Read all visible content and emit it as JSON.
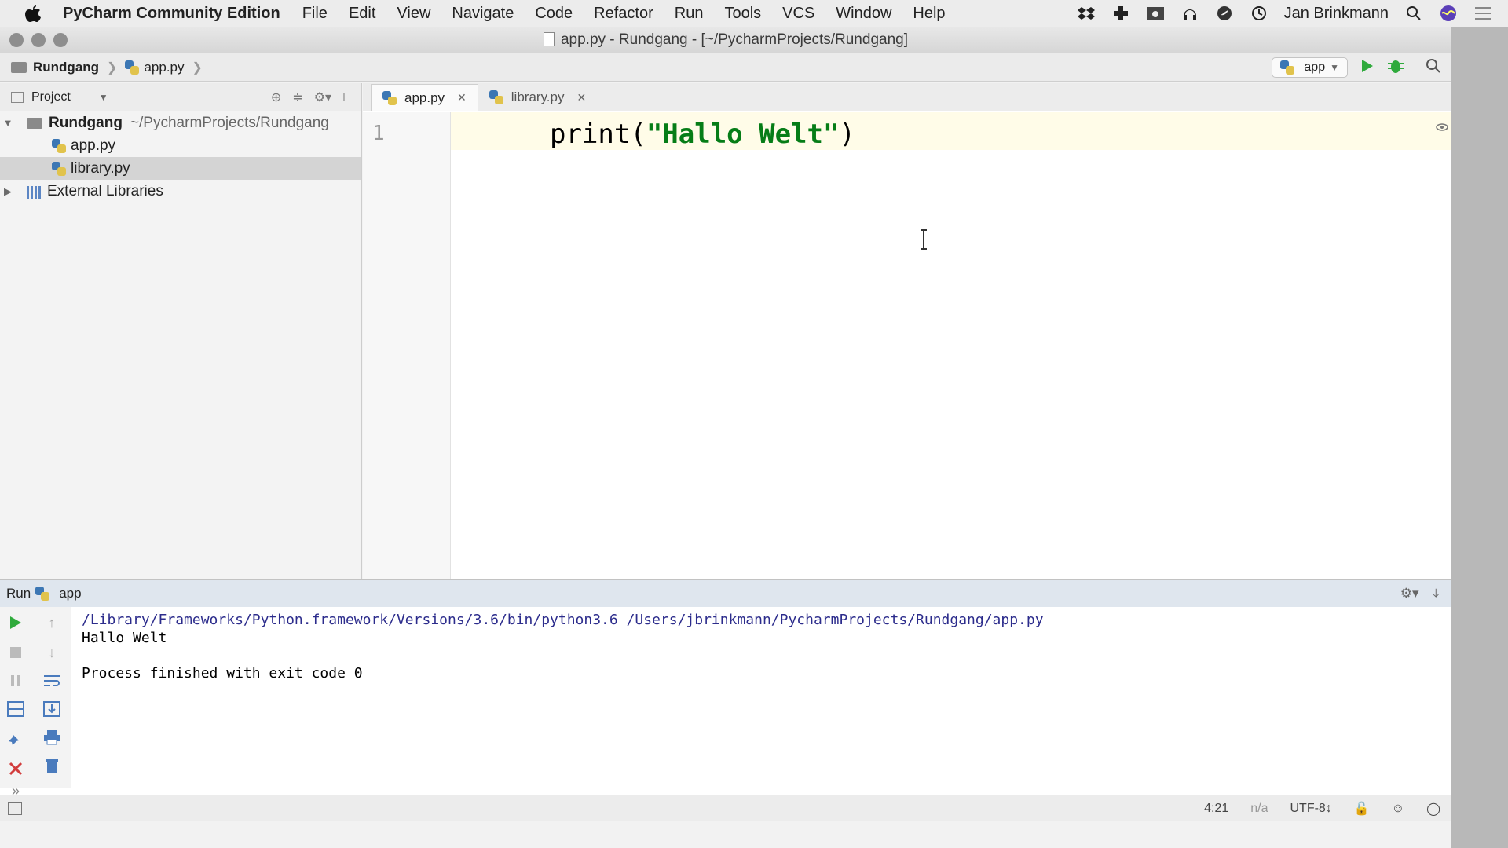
{
  "menubar": {
    "app_name": "PyCharm Community Edition",
    "menus": [
      "File",
      "Edit",
      "View",
      "Navigate",
      "Code",
      "Refactor",
      "Run",
      "Tools",
      "VCS",
      "Window",
      "Help"
    ],
    "user": "Jan Brinkmann",
    "tray_icons": [
      "dropbox-icon",
      "plugin-icon",
      "photo-icon",
      "headphones-icon",
      "bird-icon",
      "time-machine-icon",
      "search-icon",
      "siri-icon",
      "notification-list-icon"
    ]
  },
  "window": {
    "title": "app.py - Rundgang - [~/PycharmProjects/Rundgang]"
  },
  "navbar": {
    "project": "Rundgang",
    "file": "app.py",
    "run_config": "app"
  },
  "project_panel": {
    "header": "Project",
    "root": {
      "name": "Rundgang",
      "path": "~/PycharmProjects/Rundgang"
    },
    "files": [
      "app.py",
      "library.py"
    ],
    "external": "External Libraries"
  },
  "editor": {
    "tabs": [
      {
        "label": "app.py",
        "active": true
      },
      {
        "label": "library.py",
        "active": false
      }
    ],
    "line_number": "1",
    "code": {
      "func": "print(",
      "string": "\"Hallo Welt\"",
      "close": ")"
    }
  },
  "run_panel": {
    "title": "Run",
    "config": "app",
    "console": {
      "command": "/Library/Frameworks/Python.framework/Versions/3.6/bin/python3.6 /Users/jbrinkmann/PycharmProjects/Rundgang/app.py",
      "output": "Hallo Welt",
      "exit": "Process finished with exit code 0"
    }
  },
  "statusbar": {
    "position": "4:21",
    "line_sep": "n/a",
    "encoding": "UTF-8↕"
  }
}
